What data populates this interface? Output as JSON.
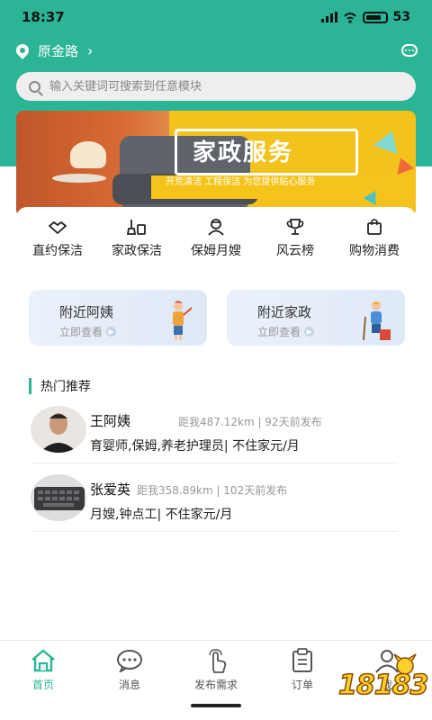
{
  "status_bar": {
    "time": "18:37",
    "battery": "53"
  },
  "location": {
    "name": "原金路"
  },
  "search": {
    "placeholder": "输入关键词可搜索到任意模块"
  },
  "banner": {
    "title": "家政服务",
    "subtitle": "开荒清洁 工程保洁   为您提供贴心服务"
  },
  "shortcuts": [
    {
      "label": "直约保洁",
      "icon": "handshake-icon"
    },
    {
      "label": "家政保洁",
      "icon": "cleaning-tools-icon"
    },
    {
      "label": "保姆月嫂",
      "icon": "nanny-icon"
    },
    {
      "label": "风云榜",
      "icon": "trophy-icon"
    },
    {
      "label": "购物消费",
      "icon": "shopping-bag-icon"
    }
  ],
  "promos": [
    {
      "title": "附近阿姨",
      "subtitle": "立即查看"
    },
    {
      "title": "附近家政",
      "subtitle": "立即查看"
    }
  ],
  "section": {
    "title": "热门推荐"
  },
  "recommendations": [
    {
      "name": "王阿姨",
      "meta": "距我487.12km | 92天前发布",
      "desc": "育婴师,保姆,养老护理员| 不住家元/月"
    },
    {
      "name": "张爱英",
      "meta": "距我358.89km | 102天前发布",
      "desc": "月嫂,钟点工| 不住家元/月"
    }
  ],
  "tabbar": [
    {
      "label": "首页",
      "icon": "home-icon",
      "active": true
    },
    {
      "label": "消息",
      "icon": "chat-icon",
      "active": false
    },
    {
      "label": "发布需求",
      "icon": "tap-hand-icon",
      "active": false
    },
    {
      "label": "订单",
      "icon": "clipboard-icon",
      "active": false
    },
    {
      "label": "我",
      "icon": "user-icon",
      "active": false
    }
  ],
  "watermark": {
    "text": "18183"
  },
  "colors": {
    "brand": "#2bb495",
    "banner_yellow": "#f3c21c"
  }
}
